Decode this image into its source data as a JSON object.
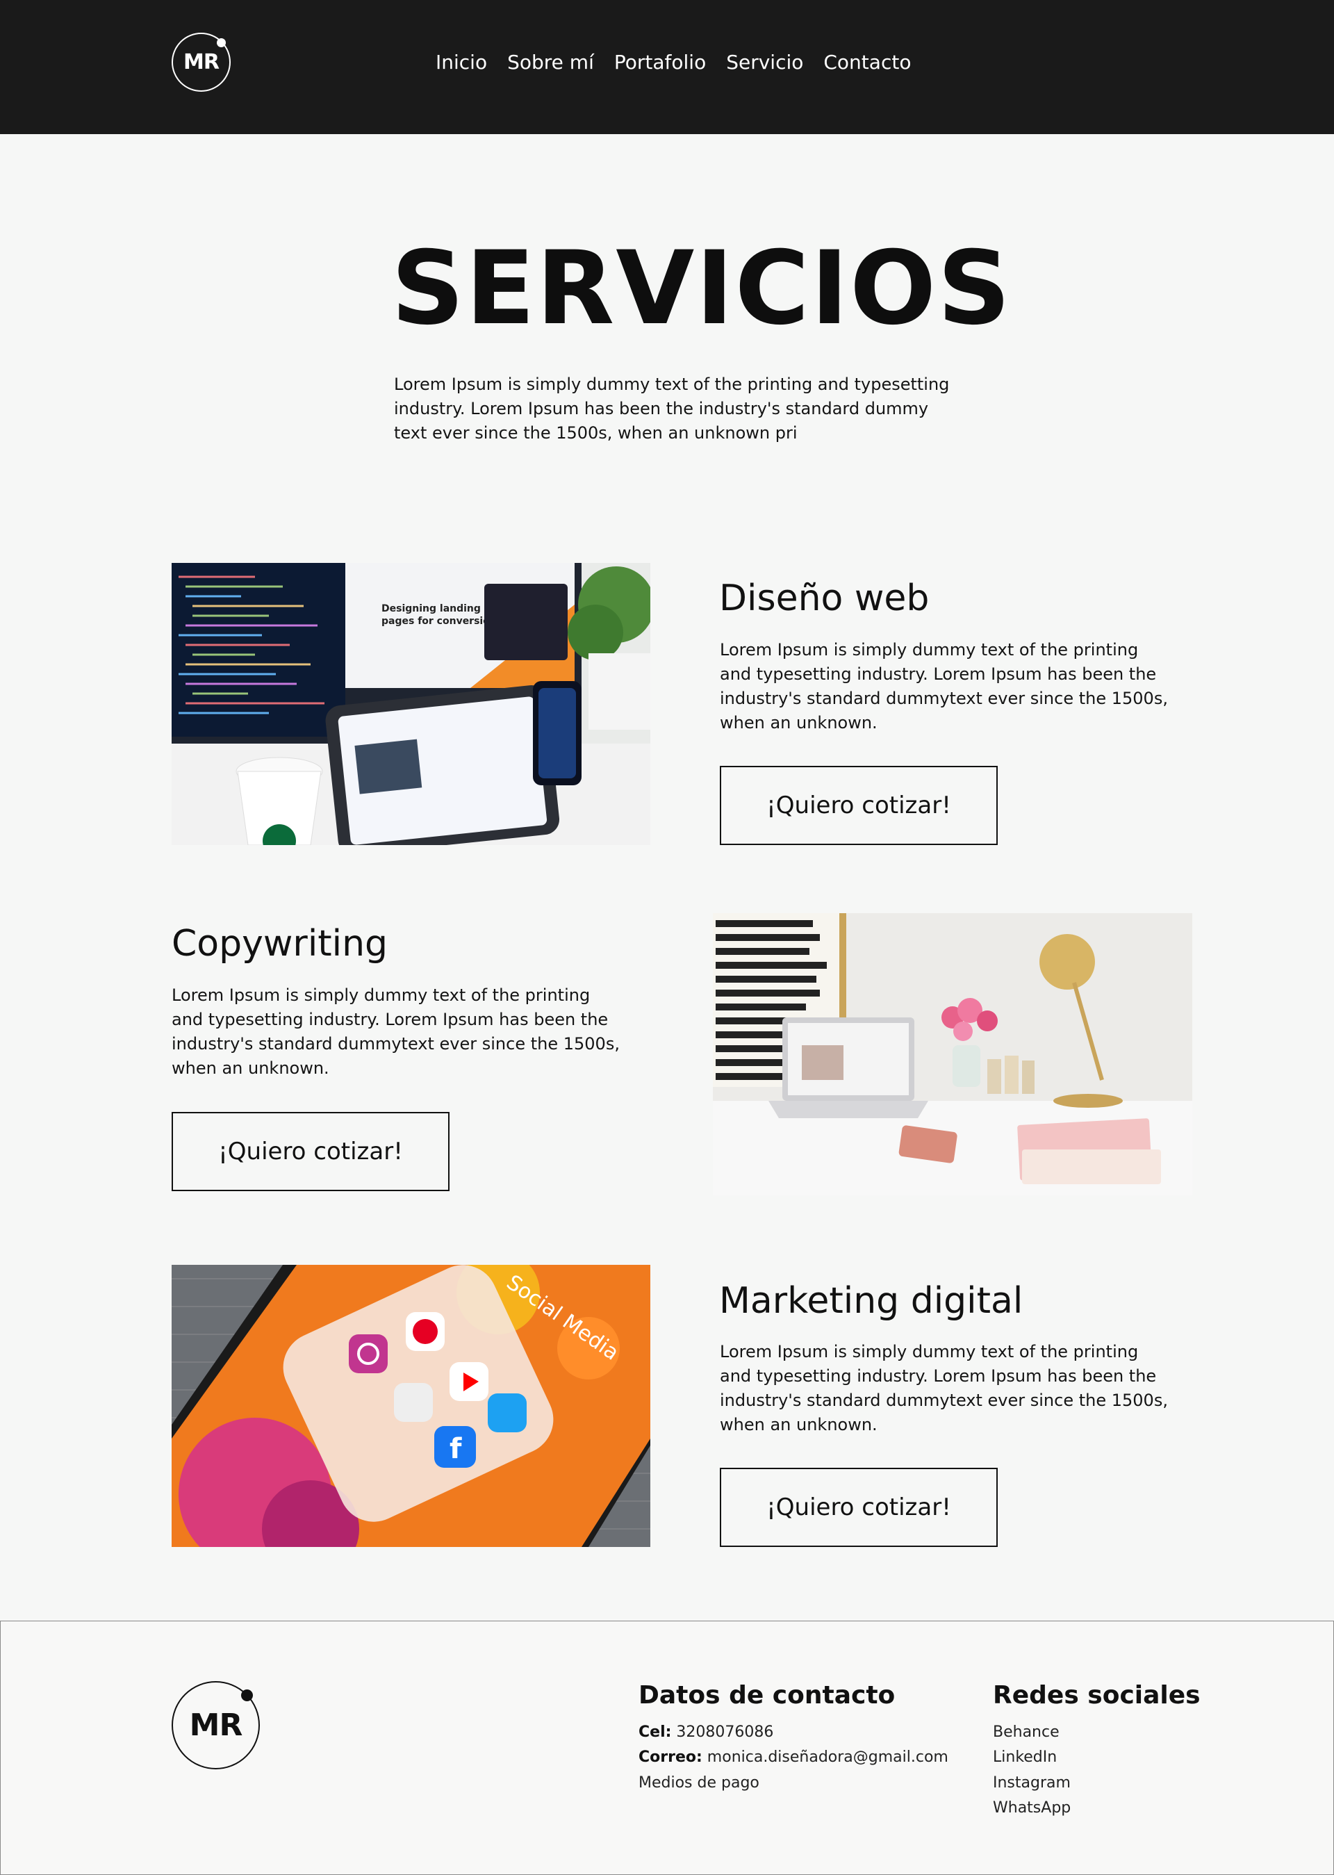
{
  "header": {
    "logo_text": "MR",
    "nav": [
      "Inicio",
      "Sobre mí",
      "Portafolio",
      "Servicio",
      "Contacto"
    ]
  },
  "hero": {
    "title": "SERVICIOS",
    "text": "Lorem Ipsum is simply dummy text of the printing and typesetting industry. Lorem Ipsum has been the industry's standard dummy text ever since the 1500s, when an unknown pri"
  },
  "services": [
    {
      "title": "Diseño web",
      "description": "Lorem Ipsum is simply dummy text of the printing and typesetting industry. Lorem Ipsum has been the industry's standard dummytext ever since the 1500s, when an unknown.",
      "button": "¡Quiero cotizar!",
      "image_screen_text": "Designing landing pages for conversion"
    },
    {
      "title": "Copywriting",
      "description": "Lorem Ipsum is simply dummy text of the printing and typesetting industry. Lorem Ipsum has been the industry's standard dummytext ever since the 1500s, when an unknown.",
      "button": "¡Quiero cotizar!"
    },
    {
      "title": "Marketing digital",
      "description": "Lorem Ipsum is simply dummy text of the printing and typesetting industry. Lorem Ipsum has been the industry's standard dummytext ever since the 1500s, when an unknown.",
      "button": "¡Quiero cotizar!",
      "image_folder_text": "Social Media"
    }
  ],
  "footer": {
    "logo_text": "MR",
    "contact": {
      "title": "Datos de contacto",
      "cel_label": "Cel:",
      "cel_value": "3208076086",
      "email_label": "Correo:",
      "email_value": "monica.diseñadora@gmail.com",
      "payment": "Medios de pago"
    },
    "social": {
      "title": "Redes sociales",
      "items": [
        "Behance",
        "LinkedIn",
        "Instagram",
        "WhatsApp"
      ]
    }
  },
  "colors": {
    "header_bg": "#1a1a1a",
    "page_bg": "#f6f7f6",
    "text": "#111111"
  }
}
